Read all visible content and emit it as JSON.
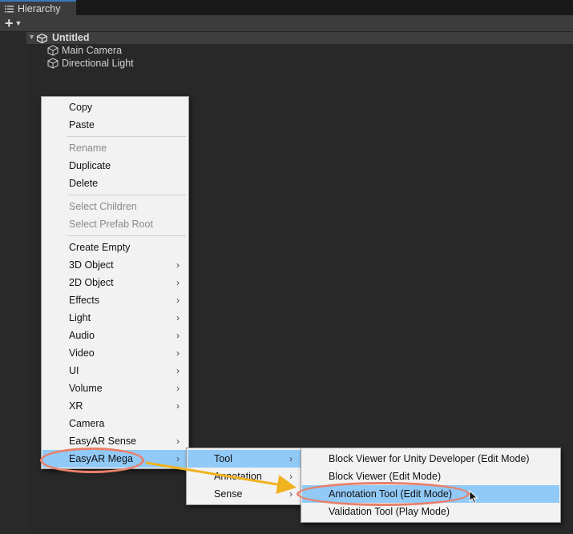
{
  "window": {
    "tab_label": "Hierarchy",
    "add_button_label": "+",
    "scene_name": "Untitled",
    "objects": [
      "Main Camera",
      "Directional Light"
    ]
  },
  "context_menu": {
    "copy": "Copy",
    "paste": "Paste",
    "rename": "Rename",
    "duplicate": "Duplicate",
    "delete": "Delete",
    "select_children": "Select Children",
    "select_prefab_root": "Select Prefab Root",
    "create_empty": "Create Empty",
    "obj3d": "3D Object",
    "obj2d": "2D Object",
    "effects": "Effects",
    "light": "Light",
    "audio": "Audio",
    "video": "Video",
    "ui": "UI",
    "volume": "Volume",
    "xr": "XR",
    "camera": "Camera",
    "easyar_sense": "EasyAR Sense",
    "easyar_mega": "EasyAR Mega"
  },
  "mega_submenu": {
    "tool": "Tool",
    "annotation": "Annotation",
    "sense": "Sense"
  },
  "tool_submenu": {
    "block_viewer_dev": "Block Viewer for Unity Developer (Edit Mode)",
    "block_viewer": "Block Viewer (Edit Mode)",
    "annotation_tool": "Annotation Tool (Edit Mode)",
    "validation_tool": "Validation Tool (Play Mode)"
  },
  "colors": {
    "menu_bg": "#f2f2f2",
    "highlight": "#91c9f7",
    "callout": "#e8806a",
    "arrow": "#f0b21e"
  },
  "icons": {
    "tab": "list-icon",
    "scene": "unity-scene-icon",
    "object": "cube-icon",
    "submenu": "chevron-right-icon"
  }
}
